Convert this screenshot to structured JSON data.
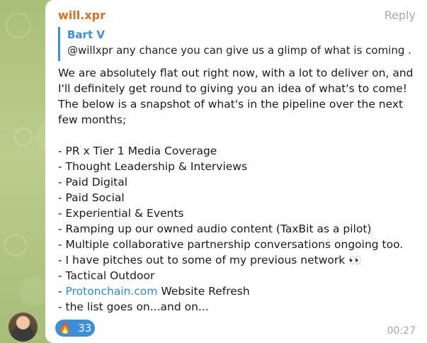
{
  "message": {
    "sender": "will.xpr",
    "reply_label": "Reply",
    "quote": {
      "author": "Bart V",
      "text": "@willxpr any chance you can give us a glimp of what is coming ..."
    },
    "body": {
      "intro": "We are absolutely flat out right now, with a lot to deliver on, and I'll definitely get round to giving you an idea of what's to come! The below is a snapshot of what's in the pipeline over the next few months;",
      "items": [
        "- PR x Tier 1 Media Coverage",
        "- Thought Leadership & Interviews",
        "- Paid Digital",
        "- Paid Social",
        "- Experiential & Events",
        "- Ramping up our owned audio content (TaxBit as a pilot)",
        "- Multiple collaborative partnership conversations ongoing too.",
        "- I have pitches out to some of my previous network",
        "- Tactical Outdoor",
        "- ",
        "- the list goes on...and on..."
      ],
      "link_text": "Protonchain.com",
      "link_suffix": " Website Refresh",
      "eyes": "👀"
    },
    "reaction": {
      "icon": "🔥",
      "count": "33"
    },
    "time": "00:27"
  },
  "colors": {
    "sender": "#d86f22",
    "accent": "#3a8fd8",
    "meta": "#a4a9ad"
  },
  "icons": {
    "avatar": "avatar-icon",
    "reaction": "fire-icon",
    "eyes": "eyes-icon"
  }
}
